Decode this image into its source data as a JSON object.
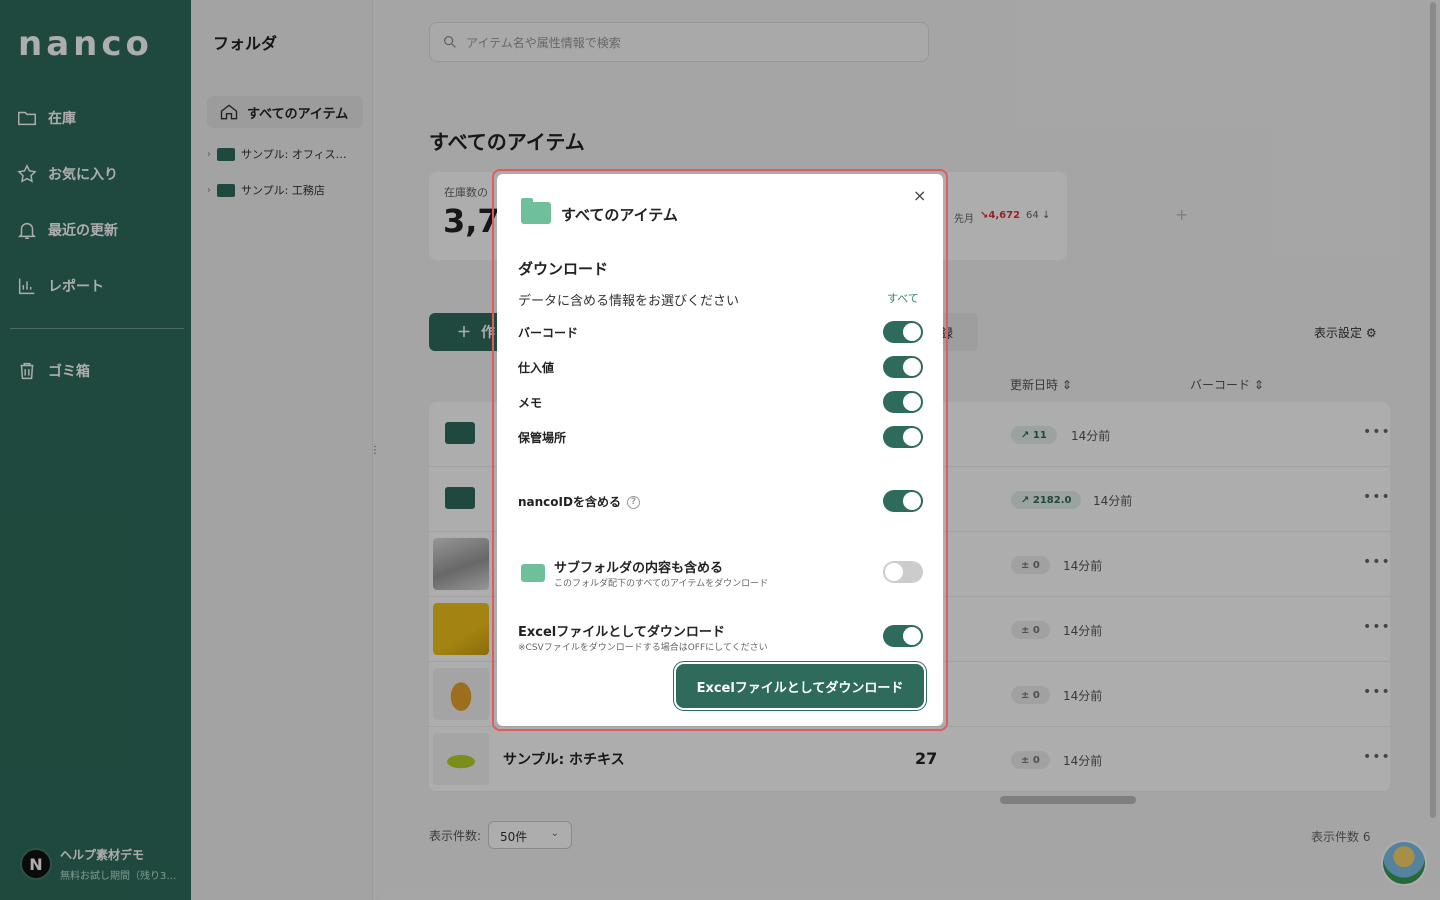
{
  "sidebar": {
    "logo": "nanco",
    "items": [
      {
        "label": "在庫",
        "icon": "folder-icon"
      },
      {
        "label": "お気に入り",
        "icon": "star-icon"
      },
      {
        "label": "最近の更新",
        "icon": "bell-icon"
      },
      {
        "label": "レポート",
        "icon": "chart-icon"
      },
      {
        "label": "ゴミ箱",
        "icon": "trash-icon"
      }
    ],
    "user": {
      "initial": "N",
      "name": "ヘルプ素材デモ",
      "plan": "無料お試し期間（残り3…"
    }
  },
  "folder_panel": {
    "title": "フォルダ",
    "all_items": "すべてのアイテム",
    "folders": [
      "サンプル: オフィス…",
      "サンプル: 工務店"
    ]
  },
  "main": {
    "search_placeholder": "アイテム名や属性情報で検索",
    "page_title": "すべてのアイテム",
    "stat": {
      "label": "在庫数の",
      "value": "3,7",
      "last_month_label": "先月",
      "last_month_delta": "4,672",
      "last_month_count": "64"
    },
    "create_label": "作",
    "register_label": "録",
    "view_settings": "表示設定",
    "columns": {
      "updated": "更新日時",
      "barcode": "バーコード"
    },
    "rows": [
      {
        "type": "folder",
        "badge": "11",
        "badge_kind": "up",
        "time": "14分前"
      },
      {
        "type": "folder",
        "badge": "2182.0",
        "badge_kind": "up",
        "time": "14分前"
      },
      {
        "type": "item",
        "badge": "± 0",
        "badge_kind": "zero",
        "time": "14分前"
      },
      {
        "type": "item",
        "badge": "± 0",
        "badge_kind": "zero",
        "time": "14分前"
      },
      {
        "type": "item",
        "badge": "± 0",
        "badge_kind": "zero",
        "time": "14分前"
      },
      {
        "type": "item",
        "name": "サンプル: ホチキス",
        "qty": "27",
        "badge": "± 0",
        "badge_kind": "zero",
        "time": "14分前"
      }
    ],
    "per_page_label": "表示件数:",
    "per_page_value": "50件",
    "total_count": "表示件数 6"
  },
  "modal": {
    "title": "すべてのアイテム",
    "section": "ダウンロード",
    "desc": "データに含める情報をお選びください",
    "select_all": "すべて",
    "options": [
      {
        "label": "バーコード",
        "on": true
      },
      {
        "label": "仕入値",
        "on": true
      },
      {
        "label": "メモ",
        "on": true
      },
      {
        "label": "保管場所",
        "on": true
      }
    ],
    "nancoid_label": "nancoIDを含める",
    "nancoid_on": true,
    "subfolder_title": "サブフォルダの内容も含める",
    "subfolder_desc": "このフォルダ配下のすべてのアイテムをダウンロード",
    "subfolder_on": false,
    "excel_title": "Excelファイルとしてダウンロード",
    "excel_desc": "※CSVファイルをダウンロードする場合はOFFにしてください",
    "excel_on": true,
    "download_button": "Excelファイルとしてダウンロード",
    "close": "×"
  },
  "colors": {
    "brand": "#2f6b5c",
    "accent_light": "#6fbf9a",
    "highlight": "#e05b5b"
  }
}
